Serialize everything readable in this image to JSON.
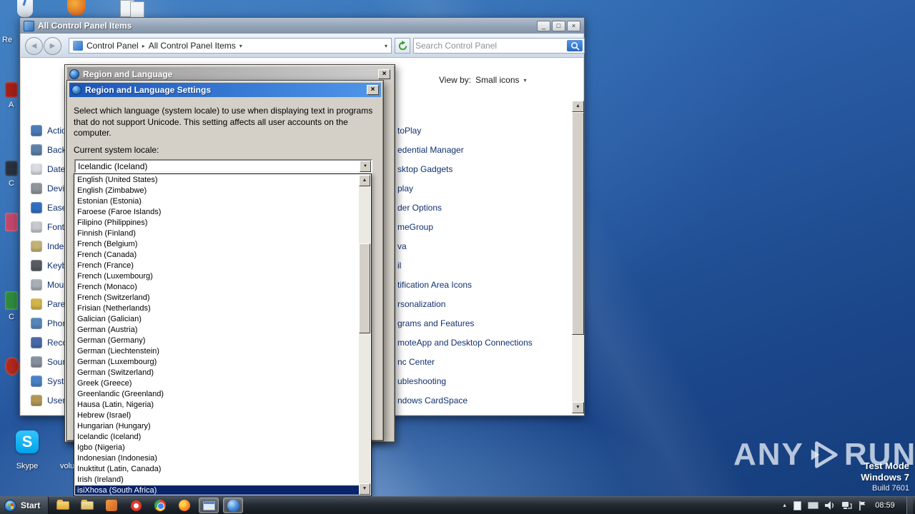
{
  "icons": {
    "minimize_glyph": "_",
    "maximize_glyph": "□",
    "close_glyph": "×",
    "back_glyph": "◀",
    "forward_glyph": "▶",
    "crumb_separator": "▸",
    "caret_down": "▾",
    "combo_arrow": "▼",
    "scroll_up": "▲",
    "scroll_down": "▼",
    "tray_expand": "▲",
    "skype_initial": "S"
  },
  "desktop": {
    "icons": {
      "skype_label": "Skype",
      "partial_label_volume": "volu",
      "fragment_1": "Re",
      "fragment_2": "A",
      "fragment_3": "C",
      "fragment_4": "C"
    },
    "watermark": {
      "brand_left": "ANY",
      "brand_right": "RUN",
      "mode": "Test Mode",
      "os": "Windows 7",
      "build": "Build 7601"
    }
  },
  "main_window": {
    "title": "All Control Panel Items",
    "breadcrumb": {
      "root": "Control Panel",
      "current": "All Control Panel Items"
    },
    "search": {
      "placeholder": "Search Control Panel"
    },
    "view_by": {
      "label": "View by:",
      "value": "Small icons"
    },
    "left_items": [
      {
        "label": "Actio",
        "icon": "action-center-icon",
        "color": "#4a7ab8"
      },
      {
        "label": "Backu",
        "icon": "backup-restore-icon",
        "color": "#5c7fa8"
      },
      {
        "label": "Date",
        "icon": "date-time-icon",
        "color": "#d9dde3"
      },
      {
        "label": "Devic",
        "icon": "device-manager-icon",
        "color": "#8f959c"
      },
      {
        "label": "Ease",
        "icon": "ease-of-access-icon",
        "color": "#2f6fc0"
      },
      {
        "label": "Fonts",
        "icon": "fonts-icon",
        "color": "#c7c9ce"
      },
      {
        "label": "Index",
        "icon": "indexing-options-icon",
        "color": "#c4b273"
      },
      {
        "label": "Keybo",
        "icon": "keyboard-icon",
        "color": "#565b61"
      },
      {
        "label": "Mous",
        "icon": "mouse-icon",
        "color": "#a9afb7"
      },
      {
        "label": "Paren",
        "icon": "parental-controls-icon",
        "color": "#d3b44a"
      },
      {
        "label": "Phone",
        "icon": "phone-modem-icon",
        "color": "#5687b8"
      },
      {
        "label": "Reco",
        "icon": "recovery-icon",
        "color": "#4668a8"
      },
      {
        "label": "Soun",
        "icon": "sound-icon",
        "color": "#87909f"
      },
      {
        "label": "Syste",
        "icon": "system-icon",
        "color": "#4a80c8"
      },
      {
        "label": "User",
        "icon": "user-accounts-icon",
        "color": "#b39755"
      }
    ],
    "right_items": [
      "toPlay",
      "edential Manager",
      "sktop Gadgets",
      "play",
      "der Options",
      "meGroup",
      "va",
      "il",
      "tification Area Icons",
      "rsonalization",
      "grams and Features",
      "moteApp and Desktop Connections",
      "nc Center",
      "ubleshooting",
      "ndows CardSpace"
    ]
  },
  "region_dialog": {
    "title": "Region and Language"
  },
  "settings_dialog": {
    "title": "Region and Language Settings",
    "instruction": "Select which language (system locale) to use when displaying text in programs that do not support Unicode. This setting affects all user accounts on the computer.",
    "locale_label": "Current system locale:",
    "selected_locale": "Icelandic (Iceland)",
    "locale_list": [
      "English (United States)",
      "English (Zimbabwe)",
      "Estonian (Estonia)",
      "Faroese (Faroe Islands)",
      "Filipino (Philippines)",
      "Finnish (Finland)",
      "French (Belgium)",
      "French (Canada)",
      "French (France)",
      "French (Luxembourg)",
      "French (Monaco)",
      "French (Switzerland)",
      "Frisian (Netherlands)",
      "Galician (Galician)",
      "German (Austria)",
      "German (Germany)",
      "German (Liechtenstein)",
      "German (Luxembourg)",
      "German (Switzerland)",
      "Greek (Greece)",
      "Greenlandic (Greenland)",
      "Hausa (Latin, Nigeria)",
      "Hebrew (Israel)",
      "Hungarian (Hungary)",
      "Icelandic (Iceland)",
      "Igbo (Nigeria)",
      "Indonesian (Indonesia)",
      "Inuktitut (Latin, Canada)",
      "Irish (Ireland)",
      "isiXhosa (South Africa)"
    ],
    "highlighted_item": "isiXhosa (South Africa)"
  },
  "taskbar": {
    "start_label": "Start",
    "clock": "08:59"
  }
}
